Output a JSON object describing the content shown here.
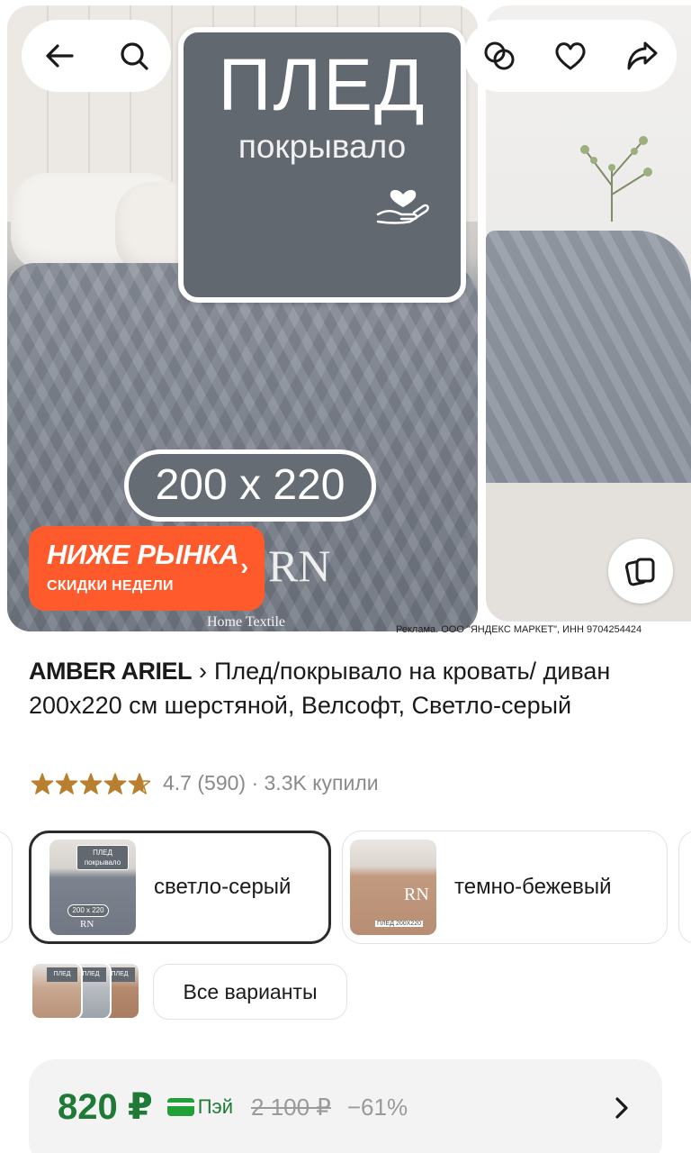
{
  "gallery": {
    "promo_title": "ПЛЕД",
    "promo_subtitle": "покрывало",
    "size_badge": "200 x 220",
    "sale_badge_title": "НИЖЕ РЫНКА",
    "sale_badge_subtitle": "СКИДКИ НЕДЕЛИ",
    "sale_badge_chevron": "›",
    "brand_mark": "RN",
    "brand_sub": "Home Textile",
    "ad_caption": "Реклама. ООО \"ЯНДЕКС МАРКЕТ\", ИНН 9704254424"
  },
  "toolbar": {
    "back_icon": "arrow-left-icon",
    "search_icon": "search-icon",
    "compare_icon": "compare-rings-icon",
    "favorite_icon": "heart-icon",
    "share_icon": "share-icon"
  },
  "product": {
    "brand": "AMBER ARIEL",
    "separator": "›",
    "title": "Плед/покрывало на кровать/ диван 200x220 см шерстяной, Велсофт, Светло-серый",
    "rating": "4.7",
    "reviews": "(590)",
    "bought": "· 3.3K купили",
    "stars_filled": 4.7,
    "star_color": "#b8802e"
  },
  "variants": {
    "items": [
      {
        "label": "светло-серый",
        "selected": true,
        "thumb_sign": "ПЛЕД покрывало",
        "thumb_size": "200 x 220",
        "thumb_brand": "RN"
      },
      {
        "label": "темно-бежевый",
        "selected": false,
        "thumb_brand": "RN",
        "thumb_caption": "ПЛЕД 200X220"
      }
    ],
    "stack_labels": [
      "ПЛЕД",
      "ПЛЕД",
      "ПЛЕД"
    ],
    "all_variants_label": "Все варианты"
  },
  "price": {
    "current": "820 ₽",
    "pay_label": "Пэй",
    "old": "2 100 ₽",
    "discount": "−61%",
    "accent": "#1e7a36"
  }
}
